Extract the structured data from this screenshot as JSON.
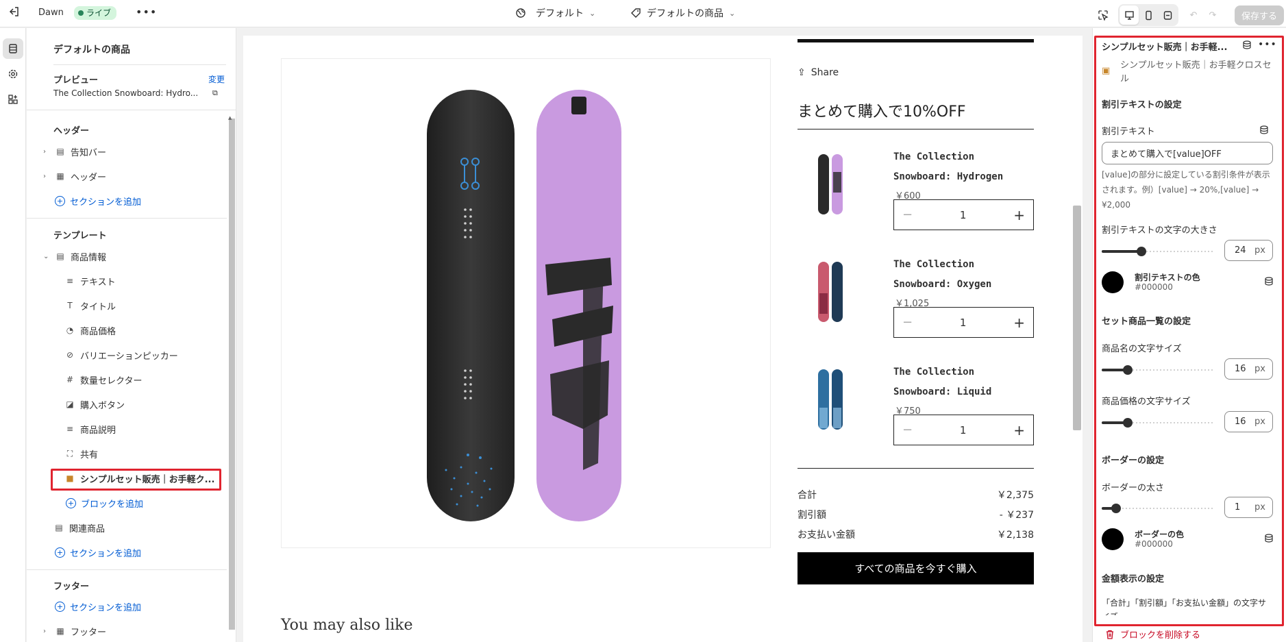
{
  "topbar": {
    "theme_name": "Dawn",
    "live_label": "ライブ",
    "preset_label": "デフォルト",
    "template_label": "デフォルトの商品",
    "save_label": "保存する"
  },
  "left_panel": {
    "title": "デフォルトの商品",
    "preview_label": "プレビュー",
    "change_label": "変更",
    "preview_product": "The Collection Snowboard: Hydro...",
    "header_group": "ヘッダー",
    "header_items": [
      "告知バー",
      "ヘッダー"
    ],
    "add_section": "セクションを追加",
    "template_group": "テンプレート",
    "product_info": "商品情報",
    "blocks": [
      "テキスト",
      "タイトル",
      "商品価格",
      "バリエーションピッカー",
      "数量セレクター",
      "購入ボタン",
      "商品説明",
      "共有"
    ],
    "selected_block": "シンプルセット販売｜お手軽ク...",
    "add_block": "ブロックを追加",
    "related_products": "関連商品",
    "footer_group": "フッター",
    "footer_item": "フッター"
  },
  "preview": {
    "share_label": "Share",
    "bundle_title": "まとめて購入で10%OFF",
    "products": [
      {
        "name": "The Collection Snowboard: Hydrogen",
        "price": "￥600",
        "qty": "1"
      },
      {
        "name": "The Collection Snowboard: Oxygen",
        "price": "￥1,025",
        "qty": "1"
      },
      {
        "name": "The Collection Snowboard: Liquid",
        "price": "￥750",
        "qty": "1"
      }
    ],
    "summary": [
      {
        "label": "合計",
        "value": "￥2,375"
      },
      {
        "label": "割引額",
        "value": "- ￥237"
      },
      {
        "label": "お支払い金額",
        "value": "￥2,138"
      }
    ],
    "buy_button": "すべての商品を今すぐ購入",
    "also_like": "You may also like"
  },
  "right_panel": {
    "title": "シンプルセット販売｜お手軽...",
    "subtitle": "シンプルセット販売｜お手軽クロスセル",
    "discount_section": "割引テキストの設定",
    "discount_text_label": "割引テキスト",
    "discount_text_value": "まとめて購入で[value]OFF",
    "discount_help": "[value]の部分に設定している割引条件が表示されます。例）[value] → 20%,[value] → ¥2,000",
    "discount_size_label": "割引テキストの文字の大きさ",
    "discount_size_value": "24",
    "unit_px": "px",
    "discount_color_label": "割引テキストの色",
    "discount_color_hex": "#000000",
    "set_list_section": "セット商品一覧の設定",
    "name_size_label": "商品名の文字サイズ",
    "name_size_value": "16",
    "price_size_label": "商品価格の文字サイズ",
    "price_size_value": "16",
    "border_section": "ボーダーの設定",
    "border_width_label": "ボーダーの太さ",
    "border_width_value": "1",
    "border_color_label": "ボーダーの色",
    "border_color_hex": "#000000",
    "amount_section": "金額表示の設定",
    "amount_help": "「合計」「割引額」「お支払い金額」の文字サイズ",
    "delete_block": "ブロックを削除する"
  },
  "colors": {
    "accent_link": "#005bd3",
    "highlight_red": "#e0242f",
    "snowboard_purple": "#c99ae0",
    "snowboard_dark": "#2a2a2a"
  },
  "slider_levels": {
    "discount_size": 0.35,
    "name_size": 0.23,
    "price_size": 0.23,
    "border_width": 0.13
  }
}
